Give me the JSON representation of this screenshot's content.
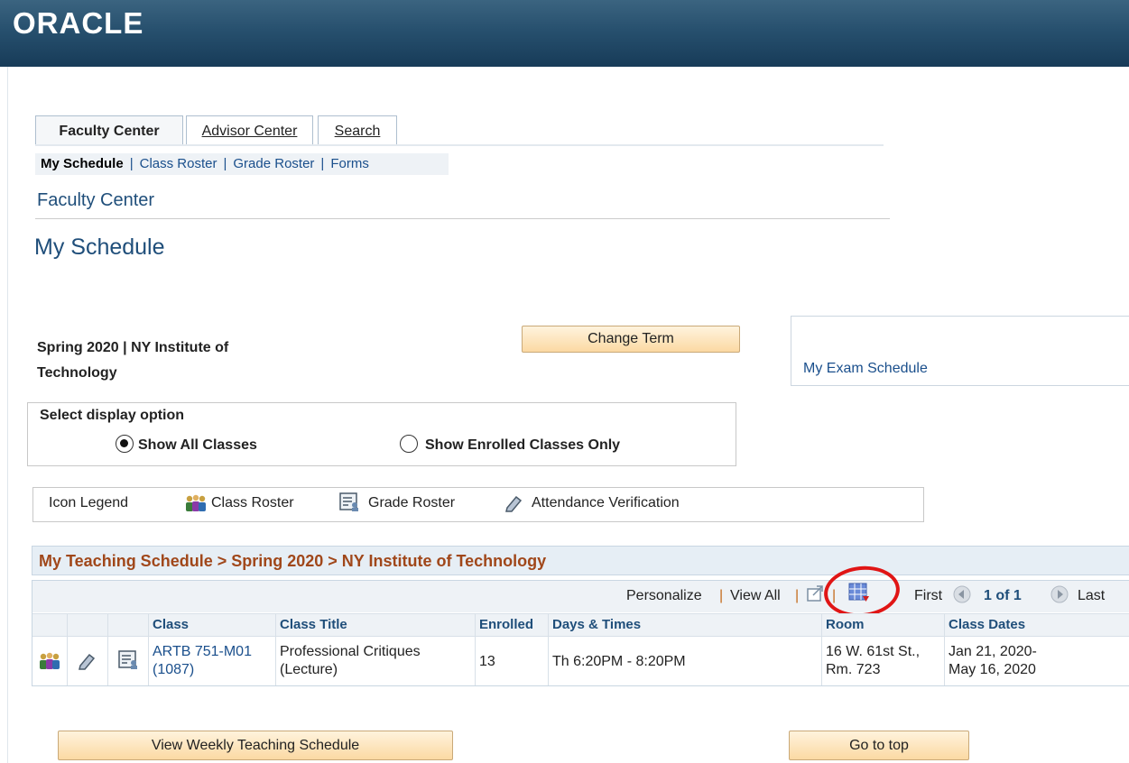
{
  "header": {
    "logo_text": "ORACLE"
  },
  "tabs": [
    {
      "label": "Faculty Center"
    },
    {
      "label": "Advisor Center"
    },
    {
      "label": "Search"
    }
  ],
  "subnav": {
    "items": [
      "My Schedule",
      "Class Roster",
      "Grade Roster",
      "Forms"
    ],
    "separator": "|"
  },
  "page": {
    "section_title": "Faculty Center",
    "title": "My Schedule",
    "term_text": "Spring 2020 | NY Institute of Technology",
    "change_term_label": "Change Term",
    "exam_link": "My Exam Schedule"
  },
  "display_option": {
    "label": "Select display option",
    "options": [
      "Show All Classes",
      "Show Enrolled Classes Only"
    ],
    "selected": "Show All Classes"
  },
  "legend": {
    "label": "Icon Legend",
    "items": [
      "Class Roster",
      "Grade Roster",
      "Attendance Verification"
    ]
  },
  "schedule": {
    "title": "My Teaching Schedule > Spring 2020 > NY Institute of Technology",
    "toolbar": {
      "personalize": "Personalize",
      "sep": "|",
      "view_all": "View All",
      "first": "First",
      "page": "1 of 1",
      "last": "Last"
    },
    "columns": [
      "Class",
      "Class Title",
      "Enrolled",
      "Days & Times",
      "Room",
      "Class Dates"
    ],
    "rows": [
      {
        "class_line1": "ARTB 751-M01",
        "class_line2": "(1087)",
        "title_line1": "Professional Critiques",
        "title_line2": "(Lecture)",
        "enrolled": "13",
        "days_times": "Th 6:20PM - 8:20PM",
        "room_line1": "16 W. 61st St.,",
        "room_line2": "Rm. 723",
        "dates_line1": "Jan 21, 2020-",
        "dates_line2": "May 16, 2020"
      }
    ]
  },
  "buttons": {
    "view_weekly": "View Weekly Teaching Schedule",
    "go_to_top": "Go to top"
  },
  "colors": {
    "header_bg": "#27506e",
    "link": "#1a4f8c",
    "grid_title": "#a0471a",
    "button": "#fbd9a3",
    "annotation_circle": "#e01515"
  },
  "icons": [
    "class-roster-icon",
    "attendance-verification-icon",
    "grade-roster-icon",
    "download-icon",
    "spreadsheet-icon",
    "prev-arrow-icon",
    "next-arrow-icon"
  ]
}
